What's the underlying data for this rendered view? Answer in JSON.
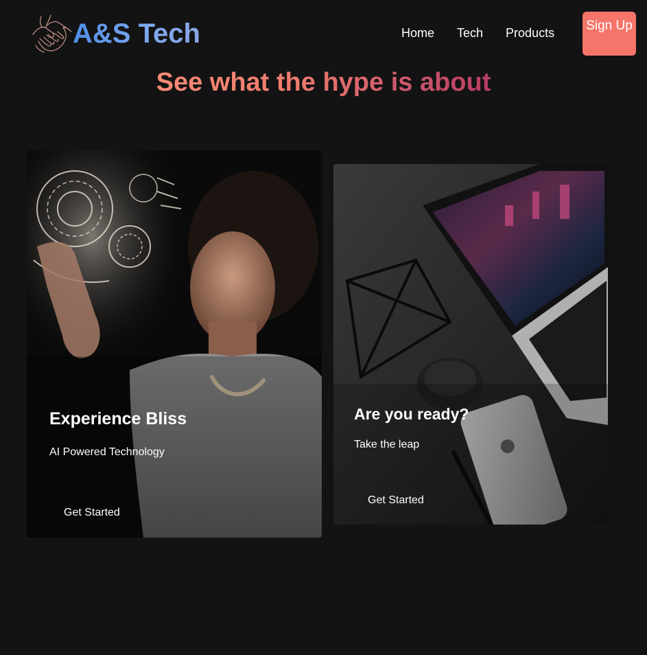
{
  "navbar": {
    "logo_icon": "handshake-icon",
    "logo_text": "A&S Tech",
    "links": [
      {
        "label": "Home"
      },
      {
        "label": "Tech"
      },
      {
        "label": "Products"
      }
    ],
    "signup_label": "Sign Up"
  },
  "hero": {
    "headline": "See what the hype is about"
  },
  "cards": [
    {
      "image": "woman-touching-holographic-interface",
      "title": "Experience Bliss",
      "subtitle": "AI Powered Technology",
      "cta": "Get Started"
    },
    {
      "image": "laptop-phone-mouse-on-desk",
      "title": "Are you ready?",
      "subtitle": "Take the leap",
      "cta": "Get Started"
    }
  ],
  "colors": {
    "background": "#131313",
    "accent": "#f5756a",
    "logo_blue": "#5a8ee6",
    "headline_start": "#f78b76",
    "headline_end": "#b43a62"
  }
}
